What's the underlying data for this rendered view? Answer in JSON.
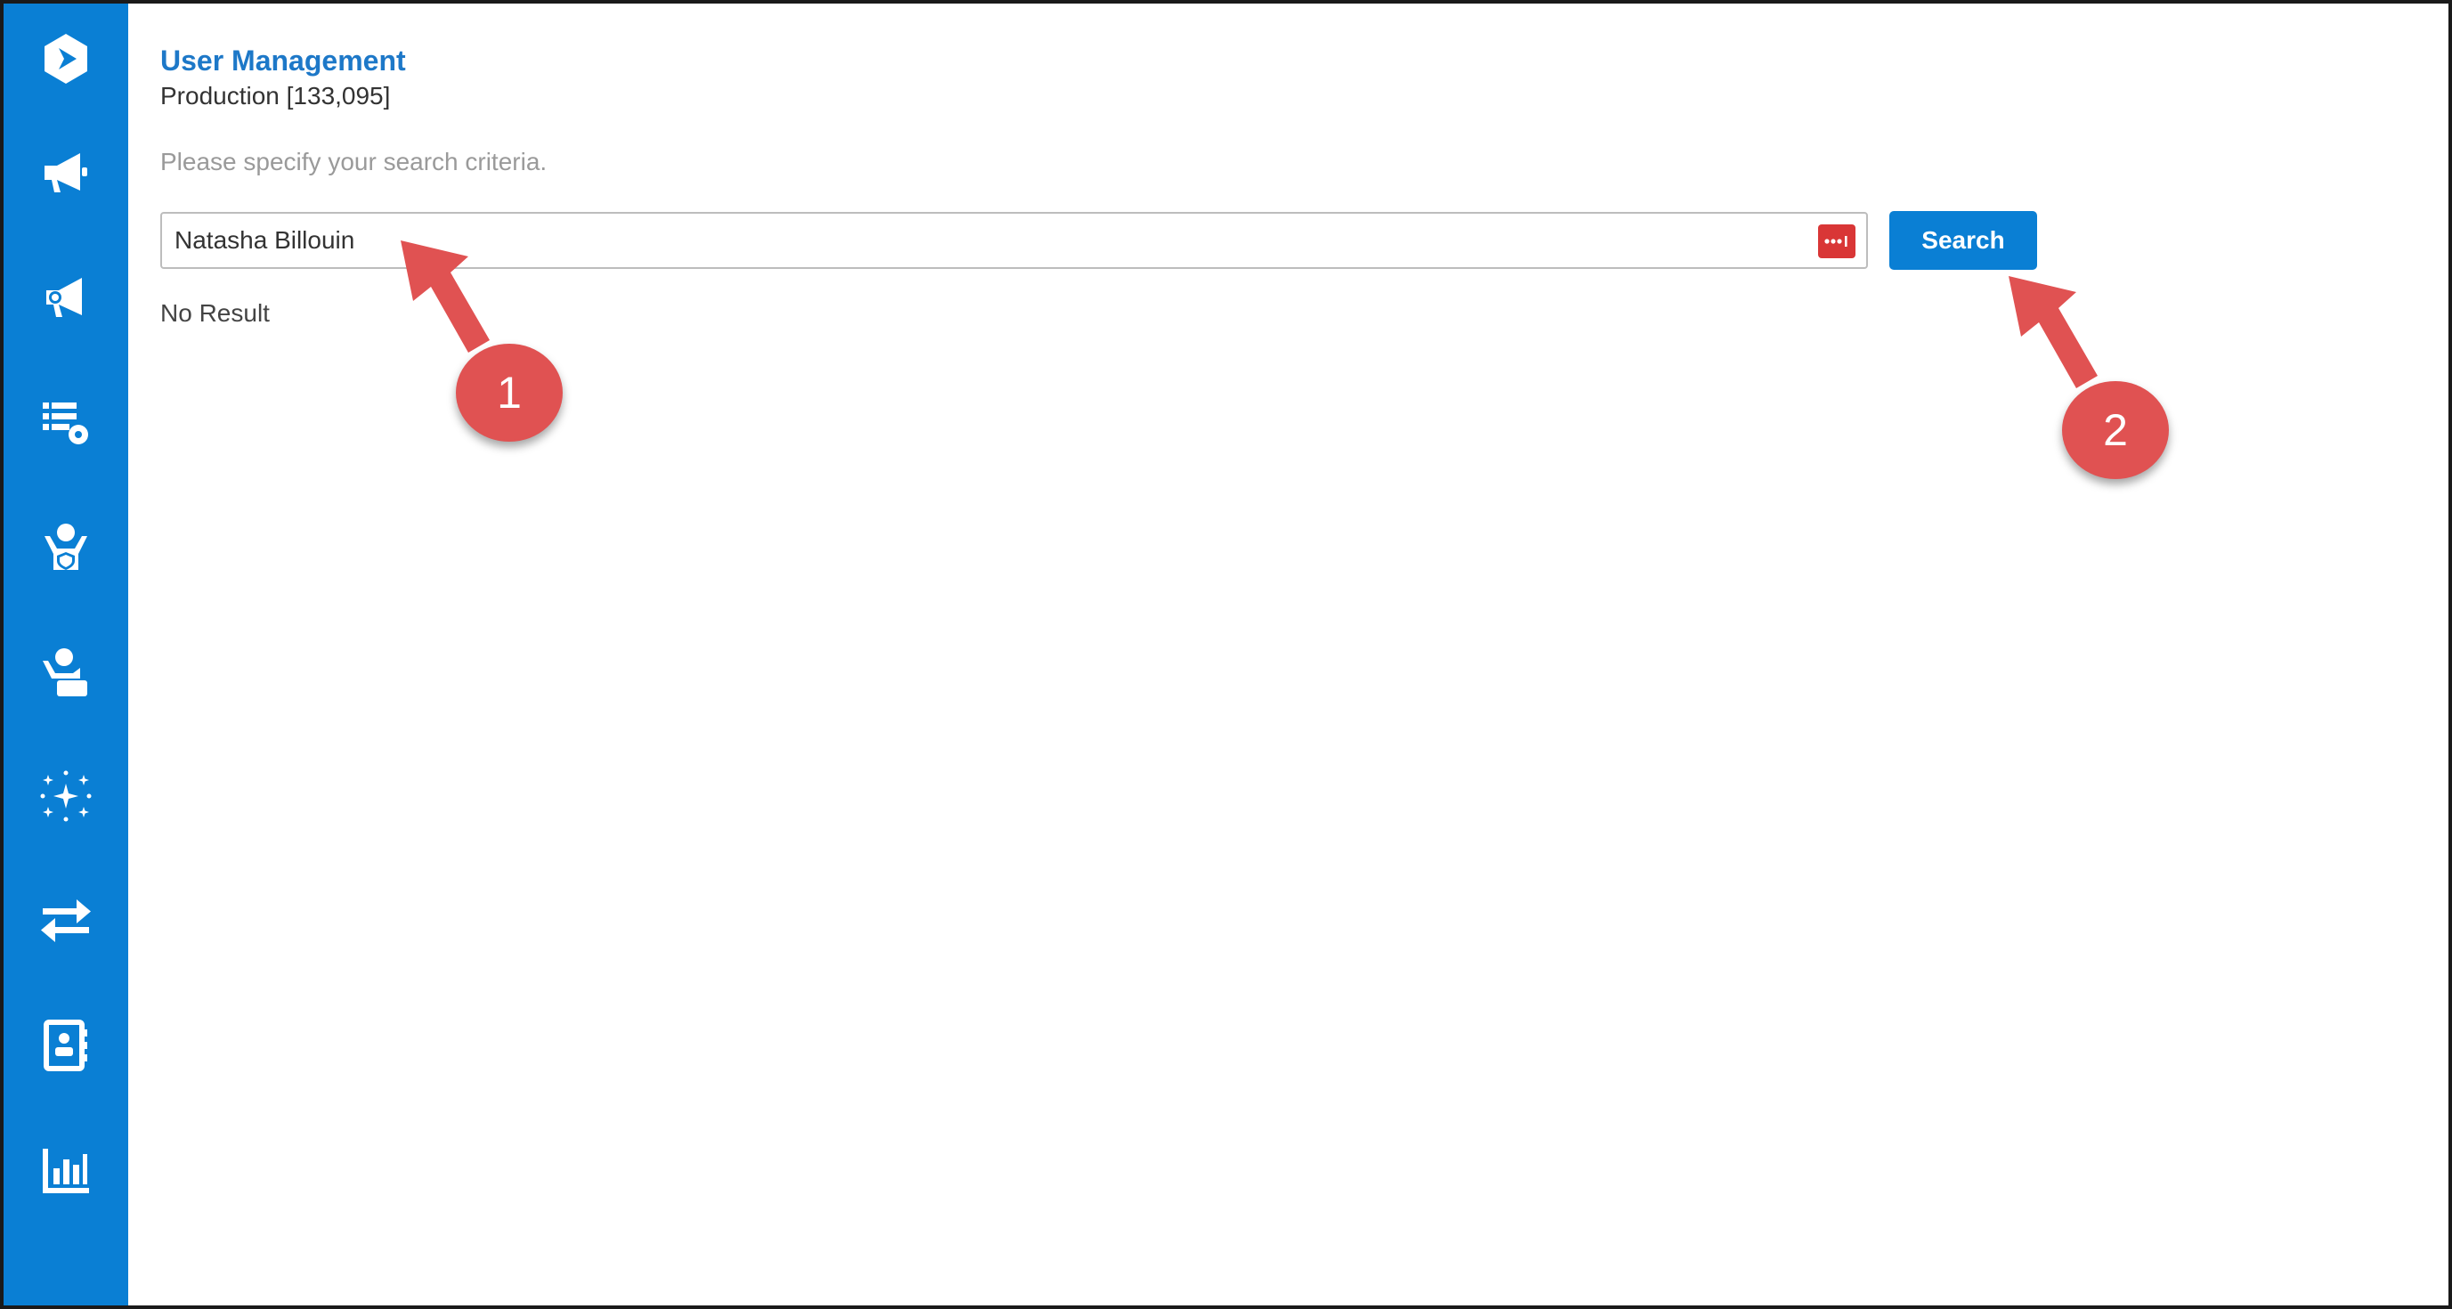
{
  "sidebar": {
    "items": [
      {
        "icon": "logo-icon"
      },
      {
        "icon": "megaphone-icon"
      },
      {
        "icon": "megaphone-settings-icon"
      },
      {
        "icon": "list-settings-icon"
      },
      {
        "icon": "user-shield-icon"
      },
      {
        "icon": "user-card-icon"
      },
      {
        "icon": "sparkle-grid-icon"
      },
      {
        "icon": "transfer-arrows-icon"
      },
      {
        "icon": "contact-book-icon"
      },
      {
        "icon": "bar-chart-icon"
      }
    ],
    "color": "#0a7fd4"
  },
  "header": {
    "title": "User Management",
    "subtitle": "Production [133,095]"
  },
  "search": {
    "instructions": "Please specify your search criteria.",
    "value": "Natasha Billouin",
    "button_label": "Search",
    "picker_icon": "ellipsis-picker-icon"
  },
  "results": {
    "message": "No Result"
  },
  "annotations": [
    {
      "number": "1"
    },
    {
      "number": "2"
    }
  ],
  "colors": {
    "accent": "#0a7fd4",
    "title": "#1d78c8",
    "annotation": "#e05252",
    "picker": "#d93636"
  }
}
